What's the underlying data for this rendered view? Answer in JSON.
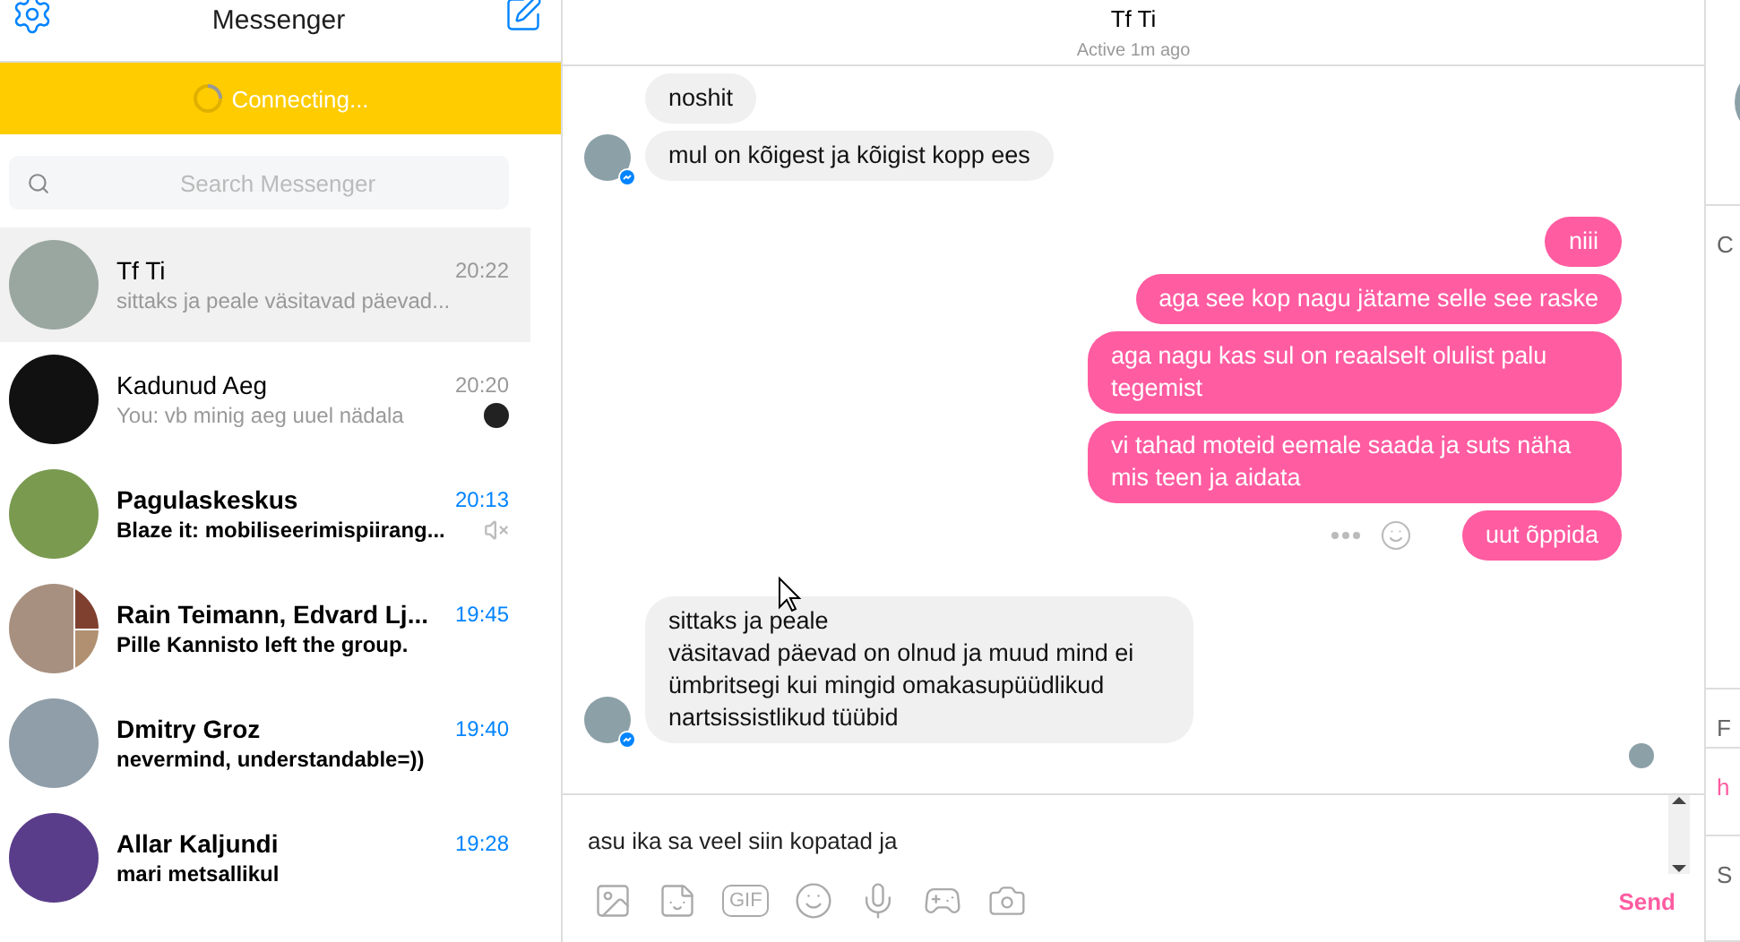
{
  "sidebar": {
    "title": "Messenger",
    "status": "Connecting...",
    "search": {
      "placeholder": "Search Messenger"
    },
    "conversations": [
      {
        "name": "Tf Ti",
        "time": "20:22",
        "preview": "sittaks ja peale väsitavad päevad...",
        "selected": true,
        "unread": false,
        "muted": false,
        "seen": false,
        "kind": "single"
      },
      {
        "name": "Kadunud Aeg",
        "time": "20:20",
        "preview": "You: vb minig aeg uuel nädala",
        "selected": false,
        "unread": false,
        "muted": false,
        "seen": true,
        "kind": "single"
      },
      {
        "name": "Pagulaskeskus",
        "time": "20:13",
        "preview": "Blaze it: mobiliseerimispiirang...",
        "selected": false,
        "unread": true,
        "muted": true,
        "seen": false,
        "kind": "single"
      },
      {
        "name": "Rain Teimann, Edvard Lj...",
        "time": "19:45",
        "preview": "Pille Kannisto left the group.",
        "selected": false,
        "unread": true,
        "muted": false,
        "seen": false,
        "kind": "group"
      },
      {
        "name": "Dmitry Groz",
        "time": "19:40",
        "preview": "nevermind, understandable=))",
        "selected": false,
        "unread": true,
        "muted": false,
        "seen": false,
        "kind": "single"
      },
      {
        "name": "Allar Kaljundi",
        "time": "19:28",
        "preview": "mari metsallikul",
        "selected": false,
        "unread": true,
        "muted": false,
        "seen": false,
        "kind": "single"
      }
    ]
  },
  "chat": {
    "title": "Tf Ti",
    "status": "Active 1m ago",
    "groups": [
      {
        "kind": "incoming",
        "messages": [
          "noshit",
          "mul on kõigest ja kõigist kopp ees"
        ],
        "seen": false
      },
      {
        "kind": "outgoing",
        "messages": [
          "niii",
          "aga see kop nagu jätame selle see raske",
          "aga nagu kas sul on reaalselt olulist palu tegemist",
          "vi tahad moteid eemale saada ja suts näha mis teen ja aidata",
          "uut õppida"
        ],
        "seen": false
      },
      {
        "kind": "incoming",
        "messages": [
          "sittaks ja peale\nväsitavad päevad on olnud ja muud mind ei ümbritsegi kui mingid omakasupüüdlikud nartsissistlikud tüübid"
        ],
        "seen": true
      }
    ],
    "composer": {
      "value": "asu ika sa veel siin kopatad ja",
      "gif": "GIF",
      "send": "Send"
    }
  },
  "details": {
    "items": [
      {
        "text": "C",
        "kind": "plain"
      },
      {
        "text": "F",
        "kind": "plain"
      },
      {
        "text": "h",
        "kind": "link"
      },
      {
        "text": "S",
        "kind": "plain"
      }
    ]
  }
}
